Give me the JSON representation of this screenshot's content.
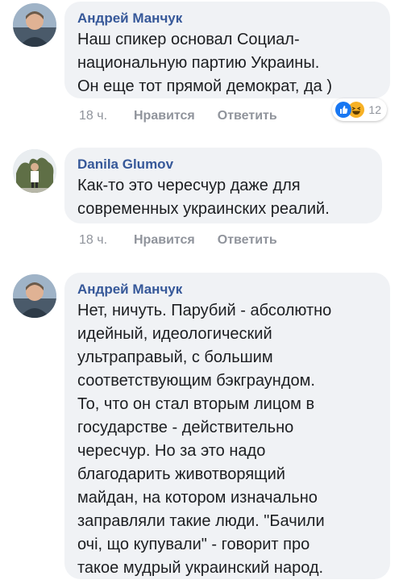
{
  "comments": [
    {
      "author": "Андрей Манчук",
      "lines": [
        "Наш спикер основал Социал-",
        "национальную партию Украины.",
        "Он еще тот прямой демократ, да )"
      ],
      "time": "18 ч.",
      "like_label": "Нравится",
      "reply_label": "Ответить",
      "reactions": {
        "icons": [
          "like-icon",
          "haha-icon"
        ],
        "count": "12"
      }
    },
    {
      "author": "Danila Glumov",
      "lines": [
        "Как-то это чересчур даже для",
        "современных украинских реалий."
      ],
      "time": "18 ч.",
      "like_label": "Нравится",
      "reply_label": "Ответить"
    },
    {
      "author": "Андрей Манчук",
      "lines": [
        "Нет, ничуть. Парубий - абсолютно",
        "идейный, идеологический",
        "ультраправый, с большим",
        "соответствующим бэкграундом.",
        "То, что он стал вторым лицом в",
        "государстве - действительно",
        "чересчур. Но за это надо",
        "благодарить животворящий",
        "майдан, на котором изначально",
        "заправляли такие люди. \"Бачили",
        "очі, що купували\" - говорит про",
        "такое мудрый украинский народ."
      ]
    }
  ],
  "colors": {
    "author": "#365899",
    "bubble": "#f0f2f5",
    "meta": "#90949c",
    "like_reaction": "#1877f2",
    "haha_reaction": "#f7b125"
  }
}
